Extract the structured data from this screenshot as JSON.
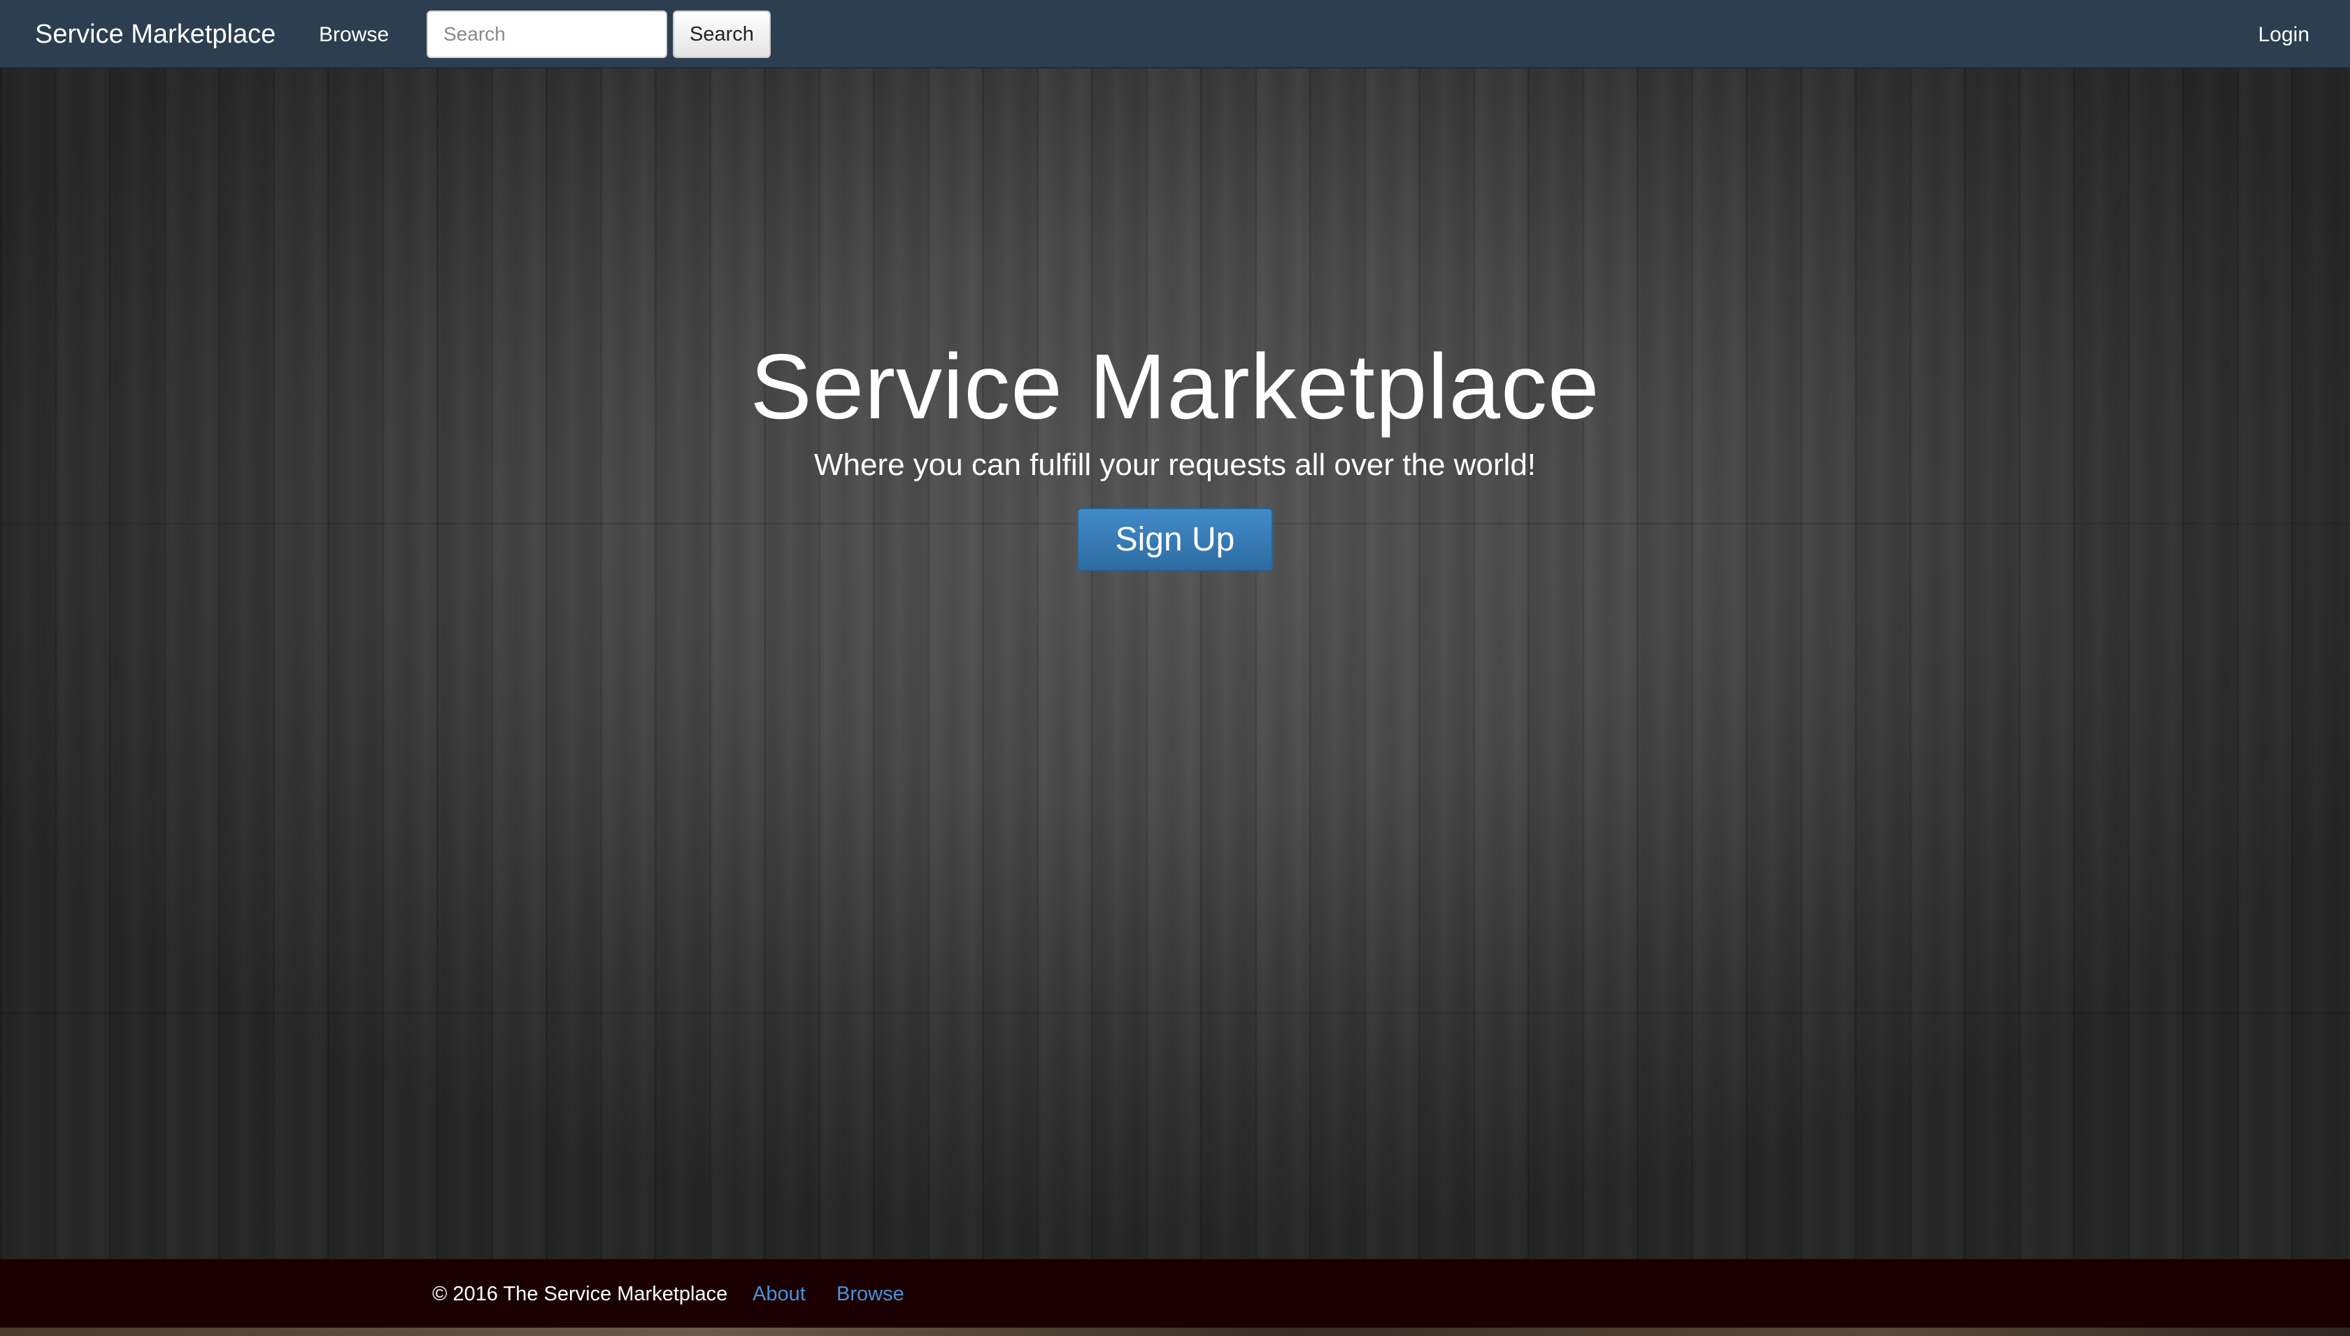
{
  "navbar": {
    "brand": "Service Marketplace",
    "browse_label": "Browse",
    "search_placeholder": "Search",
    "search_value": "",
    "search_button_label": "Search",
    "login_label": "Login",
    "background_color": "#2c3e50"
  },
  "hero": {
    "title": "Service Marketplace",
    "subtitle": "Where you can fulfill your requests all over the world!",
    "signup_label": "Sign Up",
    "signup_color": "#428bca"
  },
  "footer": {
    "copyright": "© 2016 The Service Marketplace",
    "links": [
      {
        "label": "About"
      },
      {
        "label": "Browse"
      }
    ],
    "link_color": "#4a90d9",
    "background_color": "#1a0000"
  }
}
